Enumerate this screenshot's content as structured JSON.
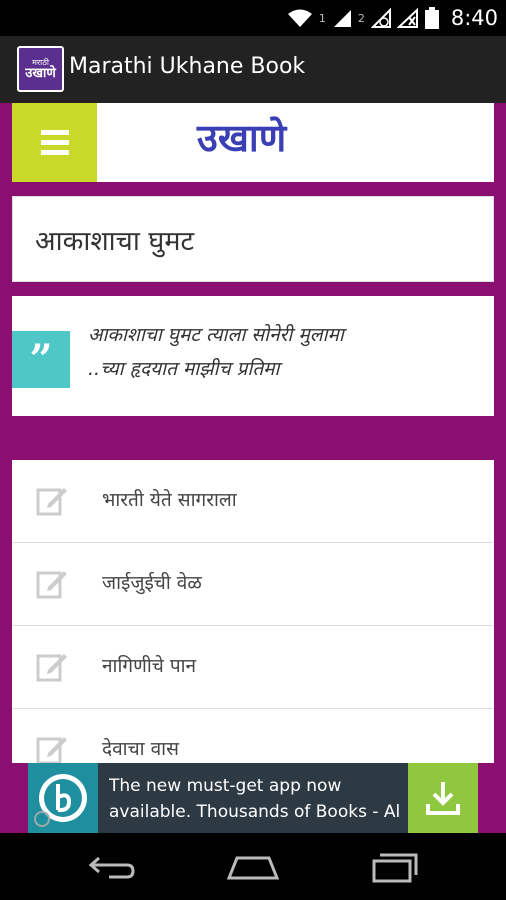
{
  "status_bar": {
    "time": "8:40",
    "sim1": "1",
    "sim2": "2"
  },
  "action_bar": {
    "title": "Marathi Ukhane Book",
    "icon_small_text": "मराठी",
    "icon_big_text": "उखाणे"
  },
  "logo_bar": {
    "logo_text": "उखाणे"
  },
  "title_card": {
    "title": "आकाशाचा घुमट"
  },
  "quote_card": {
    "line1": "आकाशाचा  घुमट त्याला सोनेरी मुलामा",
    "line2": "..च्या हृदयात माझीच प्रतिमा",
    "quote_glyph": "”"
  },
  "list": {
    "items": [
      {
        "label": "भारती येते सागराला"
      },
      {
        "label": "जाईजुईची वेळ"
      },
      {
        "label": "नागिणीचे पान"
      },
      {
        "label": "देवाचा वास"
      }
    ]
  },
  "ad": {
    "line1": "The new must-get app now",
    "line2": "available. Thousands of Books - All"
  },
  "colors": {
    "background": "#8b0e71",
    "menu_button": "#c9d92a",
    "logo_text": "#3b3fb5",
    "quote_icon": "#4fc7c7",
    "ad_download": "#8fc73e"
  }
}
